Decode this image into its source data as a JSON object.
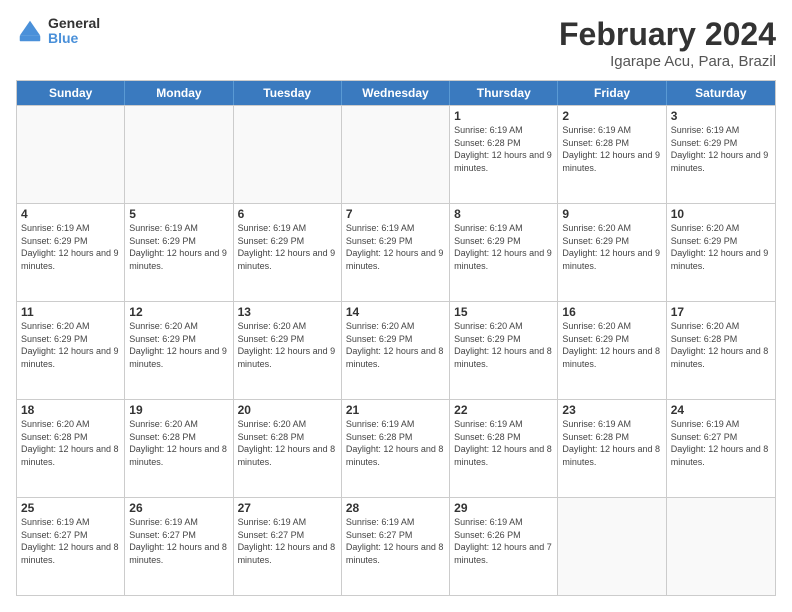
{
  "logo": {
    "text_general": "General",
    "text_blue": "Blue"
  },
  "header": {
    "title": "February 2024",
    "subtitle": "Igarape Acu, Para, Brazil"
  },
  "days_of_week": [
    "Sunday",
    "Monday",
    "Tuesday",
    "Wednesday",
    "Thursday",
    "Friday",
    "Saturday"
  ],
  "weeks": [
    [
      {
        "day": "",
        "empty": true
      },
      {
        "day": "",
        "empty": true
      },
      {
        "day": "",
        "empty": true
      },
      {
        "day": "",
        "empty": true
      },
      {
        "day": "1",
        "sunrise": "6:19 AM",
        "sunset": "6:28 PM",
        "daylight": "12 hours and 9 minutes."
      },
      {
        "day": "2",
        "sunrise": "6:19 AM",
        "sunset": "6:28 PM",
        "daylight": "12 hours and 9 minutes."
      },
      {
        "day": "3",
        "sunrise": "6:19 AM",
        "sunset": "6:29 PM",
        "daylight": "12 hours and 9 minutes."
      }
    ],
    [
      {
        "day": "4",
        "sunrise": "6:19 AM",
        "sunset": "6:29 PM",
        "daylight": "12 hours and 9 minutes."
      },
      {
        "day": "5",
        "sunrise": "6:19 AM",
        "sunset": "6:29 PM",
        "daylight": "12 hours and 9 minutes."
      },
      {
        "day": "6",
        "sunrise": "6:19 AM",
        "sunset": "6:29 PM",
        "daylight": "12 hours and 9 minutes."
      },
      {
        "day": "7",
        "sunrise": "6:19 AM",
        "sunset": "6:29 PM",
        "daylight": "12 hours and 9 minutes."
      },
      {
        "day": "8",
        "sunrise": "6:19 AM",
        "sunset": "6:29 PM",
        "daylight": "12 hours and 9 minutes."
      },
      {
        "day": "9",
        "sunrise": "6:20 AM",
        "sunset": "6:29 PM",
        "daylight": "12 hours and 9 minutes."
      },
      {
        "day": "10",
        "sunrise": "6:20 AM",
        "sunset": "6:29 PM",
        "daylight": "12 hours and 9 minutes."
      }
    ],
    [
      {
        "day": "11",
        "sunrise": "6:20 AM",
        "sunset": "6:29 PM",
        "daylight": "12 hours and 9 minutes."
      },
      {
        "day": "12",
        "sunrise": "6:20 AM",
        "sunset": "6:29 PM",
        "daylight": "12 hours and 9 minutes."
      },
      {
        "day": "13",
        "sunrise": "6:20 AM",
        "sunset": "6:29 PM",
        "daylight": "12 hours and 9 minutes."
      },
      {
        "day": "14",
        "sunrise": "6:20 AM",
        "sunset": "6:29 PM",
        "daylight": "12 hours and 8 minutes."
      },
      {
        "day": "15",
        "sunrise": "6:20 AM",
        "sunset": "6:29 PM",
        "daylight": "12 hours and 8 minutes."
      },
      {
        "day": "16",
        "sunrise": "6:20 AM",
        "sunset": "6:29 PM",
        "daylight": "12 hours and 8 minutes."
      },
      {
        "day": "17",
        "sunrise": "6:20 AM",
        "sunset": "6:28 PM",
        "daylight": "12 hours and 8 minutes."
      }
    ],
    [
      {
        "day": "18",
        "sunrise": "6:20 AM",
        "sunset": "6:28 PM",
        "daylight": "12 hours and 8 minutes."
      },
      {
        "day": "19",
        "sunrise": "6:20 AM",
        "sunset": "6:28 PM",
        "daylight": "12 hours and 8 minutes."
      },
      {
        "day": "20",
        "sunrise": "6:20 AM",
        "sunset": "6:28 PM",
        "daylight": "12 hours and 8 minutes."
      },
      {
        "day": "21",
        "sunrise": "6:19 AM",
        "sunset": "6:28 PM",
        "daylight": "12 hours and 8 minutes."
      },
      {
        "day": "22",
        "sunrise": "6:19 AM",
        "sunset": "6:28 PM",
        "daylight": "12 hours and 8 minutes."
      },
      {
        "day": "23",
        "sunrise": "6:19 AM",
        "sunset": "6:28 PM",
        "daylight": "12 hours and 8 minutes."
      },
      {
        "day": "24",
        "sunrise": "6:19 AM",
        "sunset": "6:27 PM",
        "daylight": "12 hours and 8 minutes."
      }
    ],
    [
      {
        "day": "25",
        "sunrise": "6:19 AM",
        "sunset": "6:27 PM",
        "daylight": "12 hours and 8 minutes."
      },
      {
        "day": "26",
        "sunrise": "6:19 AM",
        "sunset": "6:27 PM",
        "daylight": "12 hours and 8 minutes."
      },
      {
        "day": "27",
        "sunrise": "6:19 AM",
        "sunset": "6:27 PM",
        "daylight": "12 hours and 8 minutes."
      },
      {
        "day": "28",
        "sunrise": "6:19 AM",
        "sunset": "6:27 PM",
        "daylight": "12 hours and 8 minutes."
      },
      {
        "day": "29",
        "sunrise": "6:19 AM",
        "sunset": "6:26 PM",
        "daylight": "12 hours and 7 minutes."
      },
      {
        "day": "",
        "empty": true
      },
      {
        "day": "",
        "empty": true
      }
    ]
  ],
  "labels": {
    "sunrise": "Sunrise:",
    "sunset": "Sunset:",
    "daylight": "Daylight:"
  }
}
